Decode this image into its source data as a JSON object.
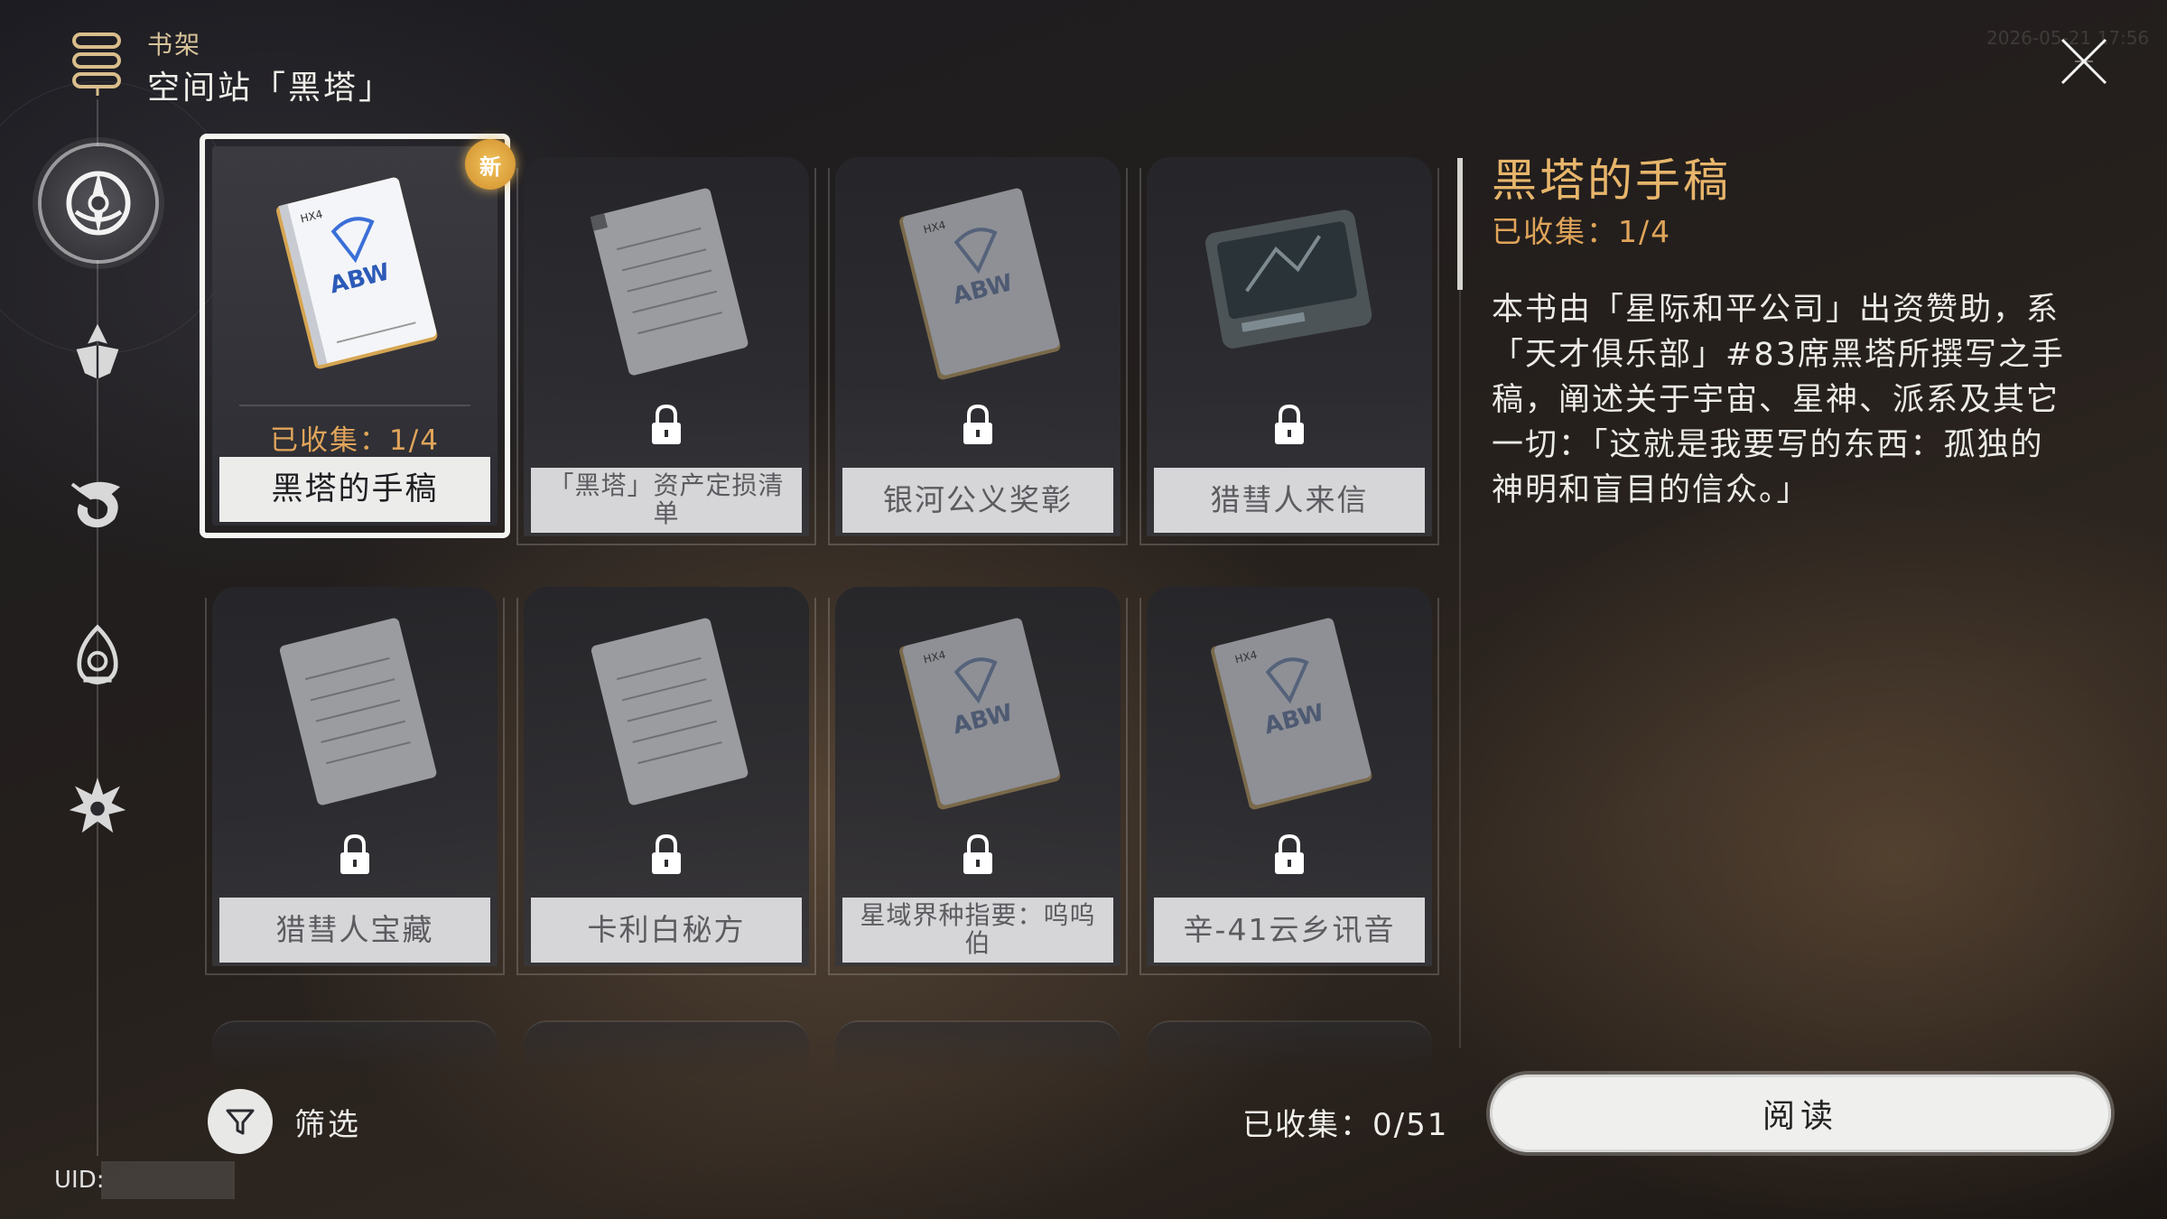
{
  "header": {
    "category": "书架",
    "location": "空间站「黑塔」",
    "timestamp": "2026-05-21 17:56"
  },
  "sidebar": {
    "items": [
      {
        "icon": "compass-emblem-icon",
        "active": true
      },
      {
        "icon": "crystal-flower-emblem-icon",
        "active": false
      },
      {
        "icon": "dragon-emblem-icon",
        "active": false
      },
      {
        "icon": "flame-lantern-emblem-icon",
        "active": false
      },
      {
        "icon": "spiky-star-emblem-icon",
        "active": false
      }
    ]
  },
  "books": [
    {
      "title": "黑塔的手稿",
      "collected": "已收集：1/4",
      "new_badge": "新",
      "locked": false,
      "selected": true,
      "cover": "blue-logo"
    },
    {
      "title": "「黑塔」资产定损清单",
      "locked": true,
      "cover": "notepad"
    },
    {
      "title": "银河公义奖彰",
      "locked": true,
      "cover": "blue-logo"
    },
    {
      "title": "猎彗人来信",
      "locked": true,
      "cover": "tablet"
    },
    {
      "title": "猎彗人宝藏",
      "locked": true,
      "cover": "notepad"
    },
    {
      "title": "卡利白秘方",
      "locked": true,
      "cover": "notepad"
    },
    {
      "title": "星域界种指要：呜呜伯",
      "locked": true,
      "cover": "blue-logo"
    },
    {
      "title": "辛-41云乡讯音",
      "locked": true,
      "cover": "blue-logo"
    }
  ],
  "footer": {
    "filter_label": "筛选",
    "total_collected": "已收集：0/51",
    "uid_label": "UID:"
  },
  "detail": {
    "title": "黑塔的手稿",
    "collected": "已收集：1/4",
    "description": "本书由「星际和平公司」出资赞助，系「天才俱乐部」#83席黑塔所撰写之手稿，阐述关于宇宙、星神、派系及其它一切：「这就是我要写的东西：孤独的神明和盲目的信众。」",
    "read_button": "阅读"
  },
  "colors": {
    "accent_gold": "#e7b56b",
    "collected_orange": "#e0a45a",
    "new_badge": "#e0a440"
  }
}
